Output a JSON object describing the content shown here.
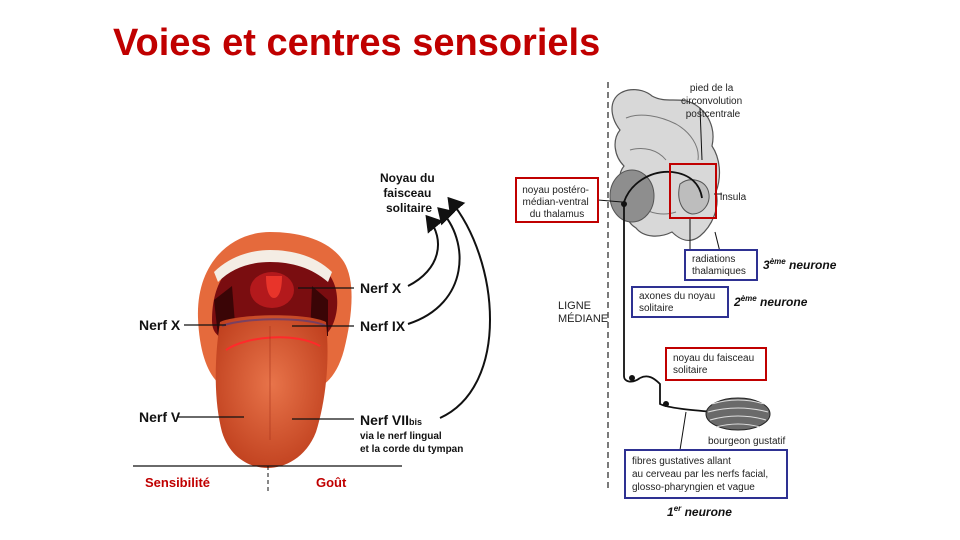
{
  "title": "Voies et centres sensoriels",
  "left_figure": {
    "top_label_lines": [
      "Noyau du",
      "faisceau",
      "solitaire"
    ],
    "nerf_x_right": "Nerf X",
    "nerf_ix": "Nerf IX",
    "nerf_x_left": "Nerf X",
    "nerf_v": "Nerf V",
    "nerf_vii_main": "Nerf VII",
    "nerf_vii_sub": "bis",
    "nerf_vii_desc": [
      "via le nerf lingual",
      "et la corde du tympan"
    ],
    "sensibilite": "Sensibilité",
    "gout": "Goût"
  },
  "right_figure": {
    "pied_lines": [
      "pied de la",
      "circonvolution",
      "postcentrale"
    ],
    "insula": "insula",
    "thalamus_lines": [
      "noyau postéro-",
      "médian-ventral",
      "du thalamus"
    ],
    "radiations_lines": [
      "radiations",
      "thalamiques"
    ],
    "neuron3_num": "3",
    "neuron3_sup": "ème",
    "neuron3_word": " neurone",
    "ligne_lines": [
      "LIGNE",
      "MÉDIANE"
    ],
    "axones_lines": [
      "axones du noyau",
      "solitaire"
    ],
    "neuron2_num": "2",
    "neuron2_sup": "ème",
    "neuron2_word": " neurone",
    "noyau_lines": [
      "noyau du faisceau",
      "solitaire"
    ],
    "bourgeon": "bourgeon gustatif",
    "fibres_lines": [
      "fibres gustatives allant",
      "au cerveau par les nerfs facial,",
      "glosso-pharyngien et vague"
    ],
    "neuron1_num": "1",
    "neuron1_sup": "er",
    "neuron1_word": " neurone"
  },
  "colors": {
    "title": "#c00000",
    "red_box": "#c00000",
    "blue_box": "#2e3192",
    "tongue": "#d9532c"
  }
}
